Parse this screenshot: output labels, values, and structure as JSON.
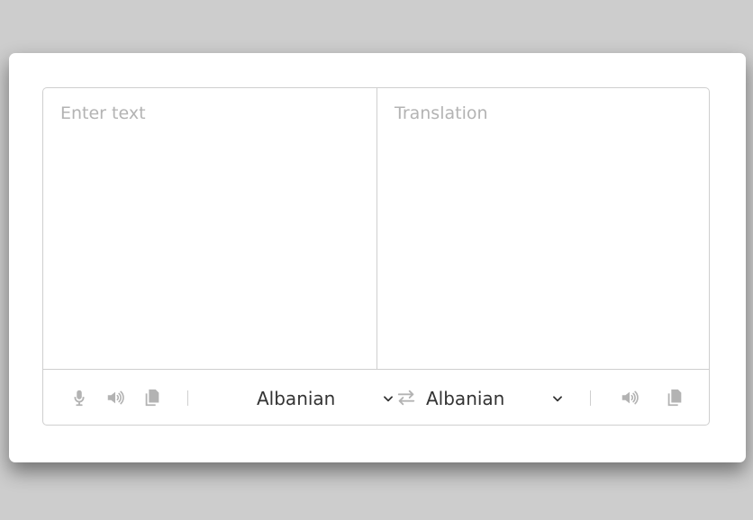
{
  "input": {
    "placeholder": "Enter text"
  },
  "output": {
    "placeholder": "Translation"
  },
  "from_language": {
    "selected": "Albanian"
  },
  "to_language": {
    "selected": "Albanian"
  },
  "icons": {
    "mic": "microphone-icon",
    "speaker": "speaker-icon",
    "copy": "copy-icon",
    "swap": "swap-arrows-icon",
    "chevron": "chevron-down-icon"
  },
  "colors": {
    "background": "#cdcdcd",
    "card": "#ffffff",
    "border": "#cfcfcf",
    "icon": "#b3b3b3",
    "text": "#333333",
    "placeholder": "#b3b3b3"
  }
}
